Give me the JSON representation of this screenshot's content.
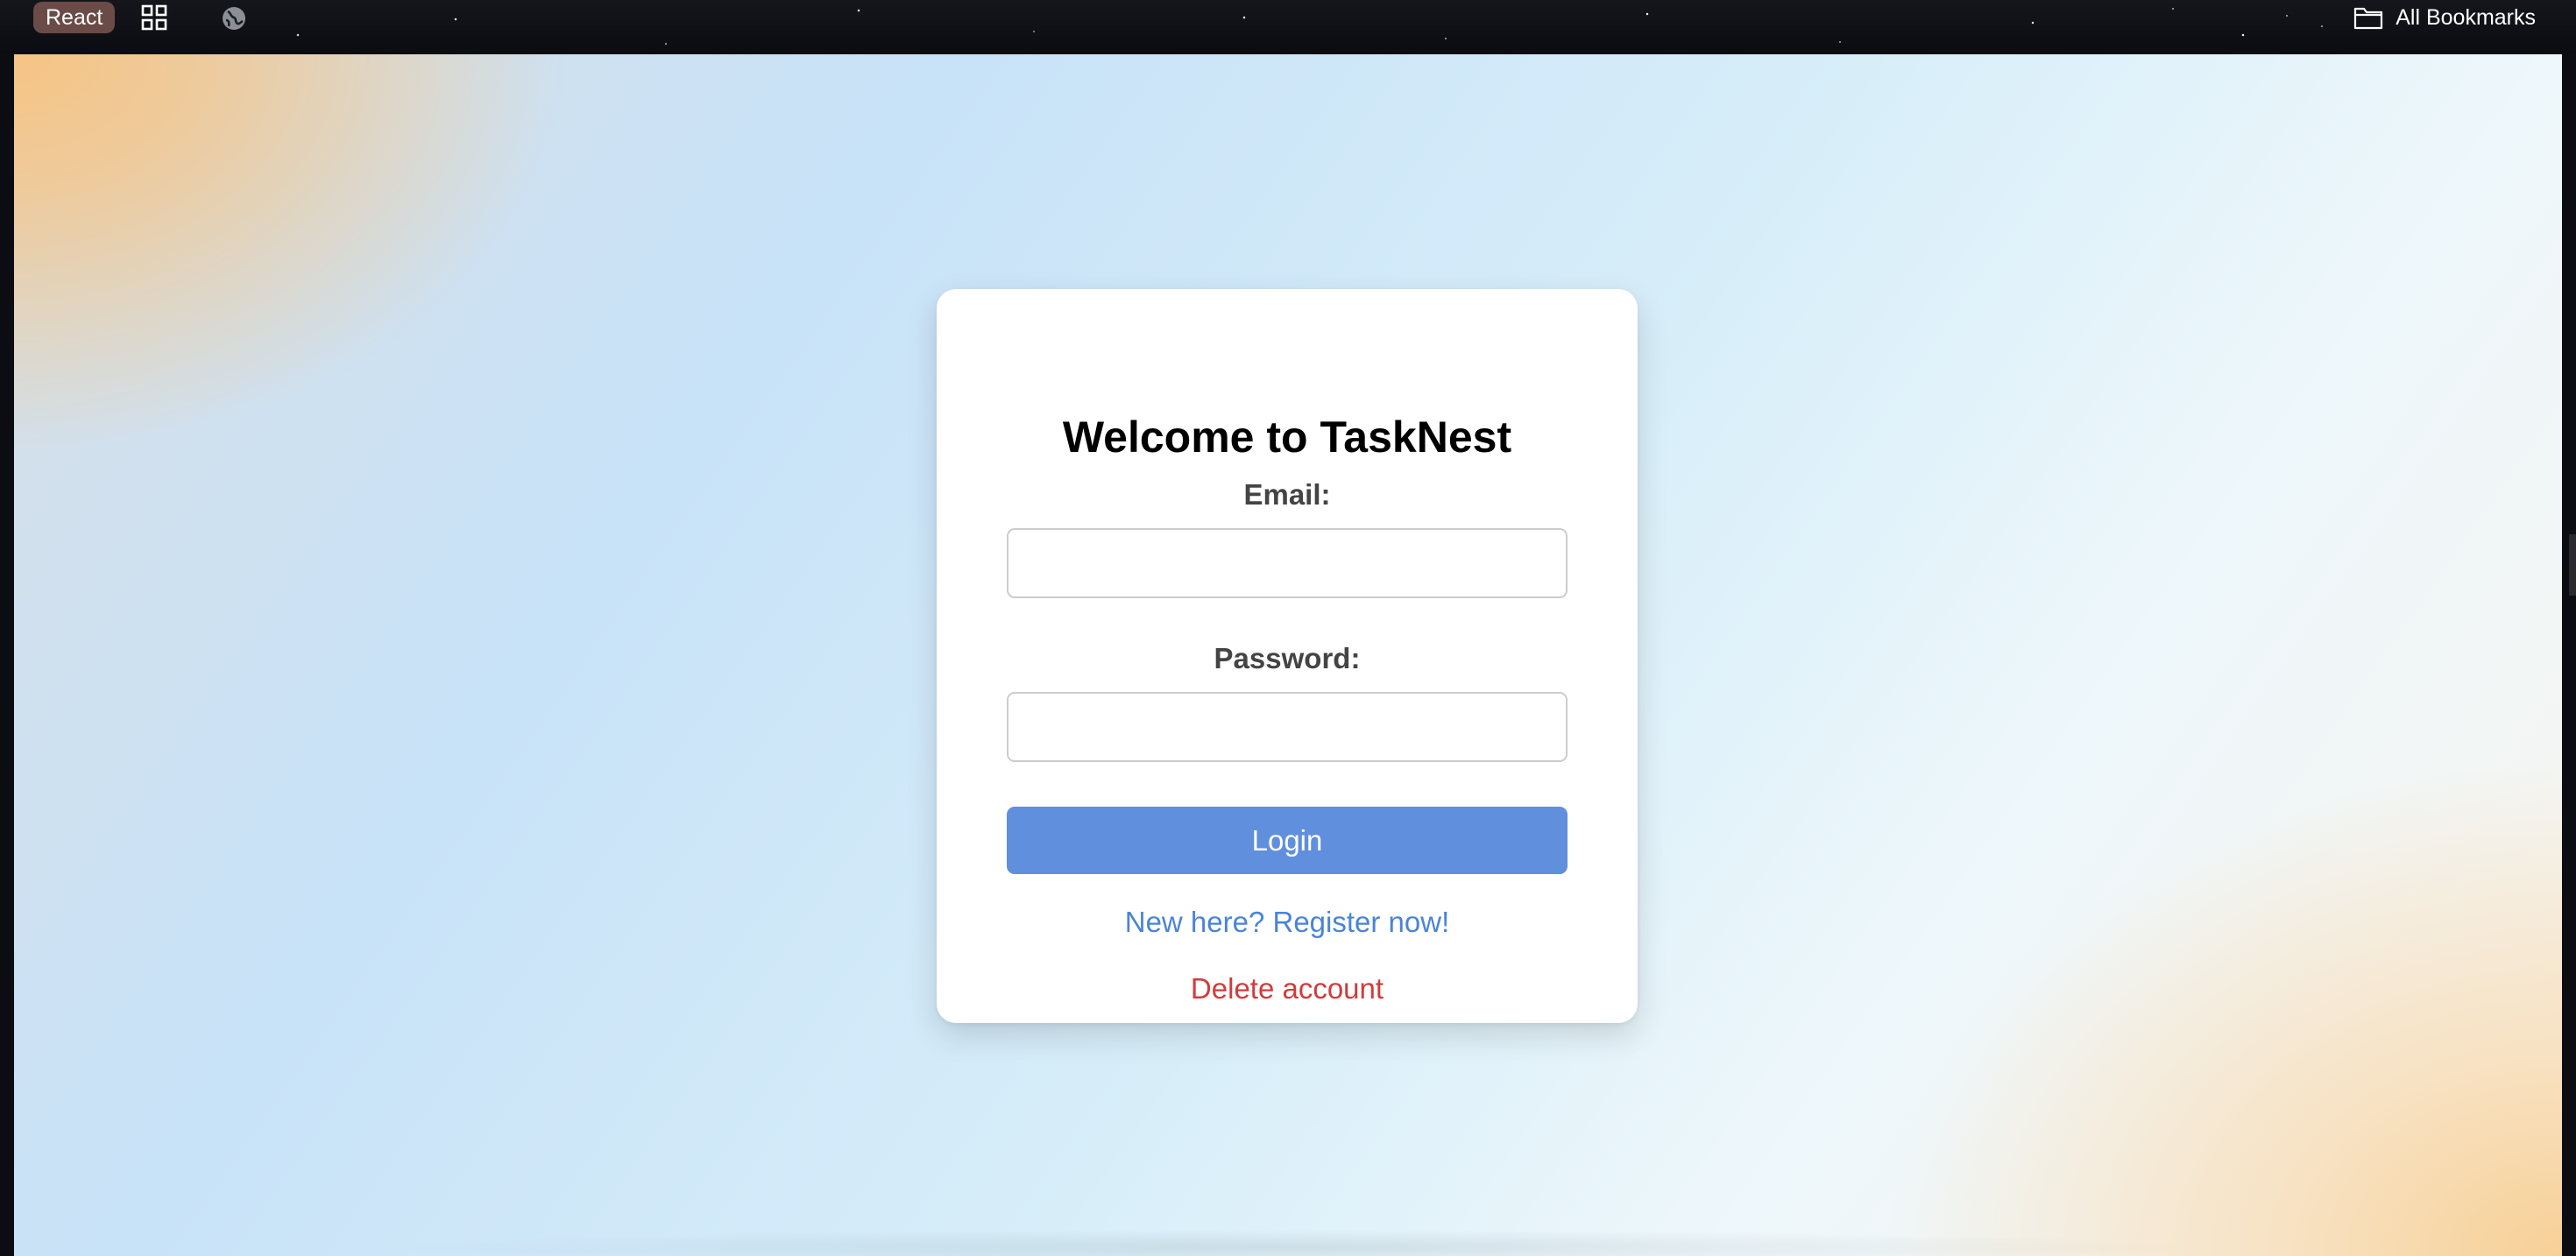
{
  "bookmarks_bar": {
    "items": [
      {
        "label": "React"
      }
    ],
    "icons": [
      "apps-grid-icon",
      "globe-icon",
      "folder-icon"
    ],
    "all_bookmarks_label": "All Bookmarks",
    "chip_color": "#6a4b47"
  },
  "login": {
    "title": "Welcome to TaskNest",
    "email_label": "Email:",
    "email_value": "",
    "password_label": "Password:",
    "password_value": "",
    "login_button": "Login",
    "register_link": "New here? Register now!",
    "delete_link": "Delete account"
  },
  "colors": {
    "primary_button": "#5f8fdd",
    "link": "#4a84d8",
    "danger_link": "#d23b3b",
    "card_background": "#ffffff"
  }
}
